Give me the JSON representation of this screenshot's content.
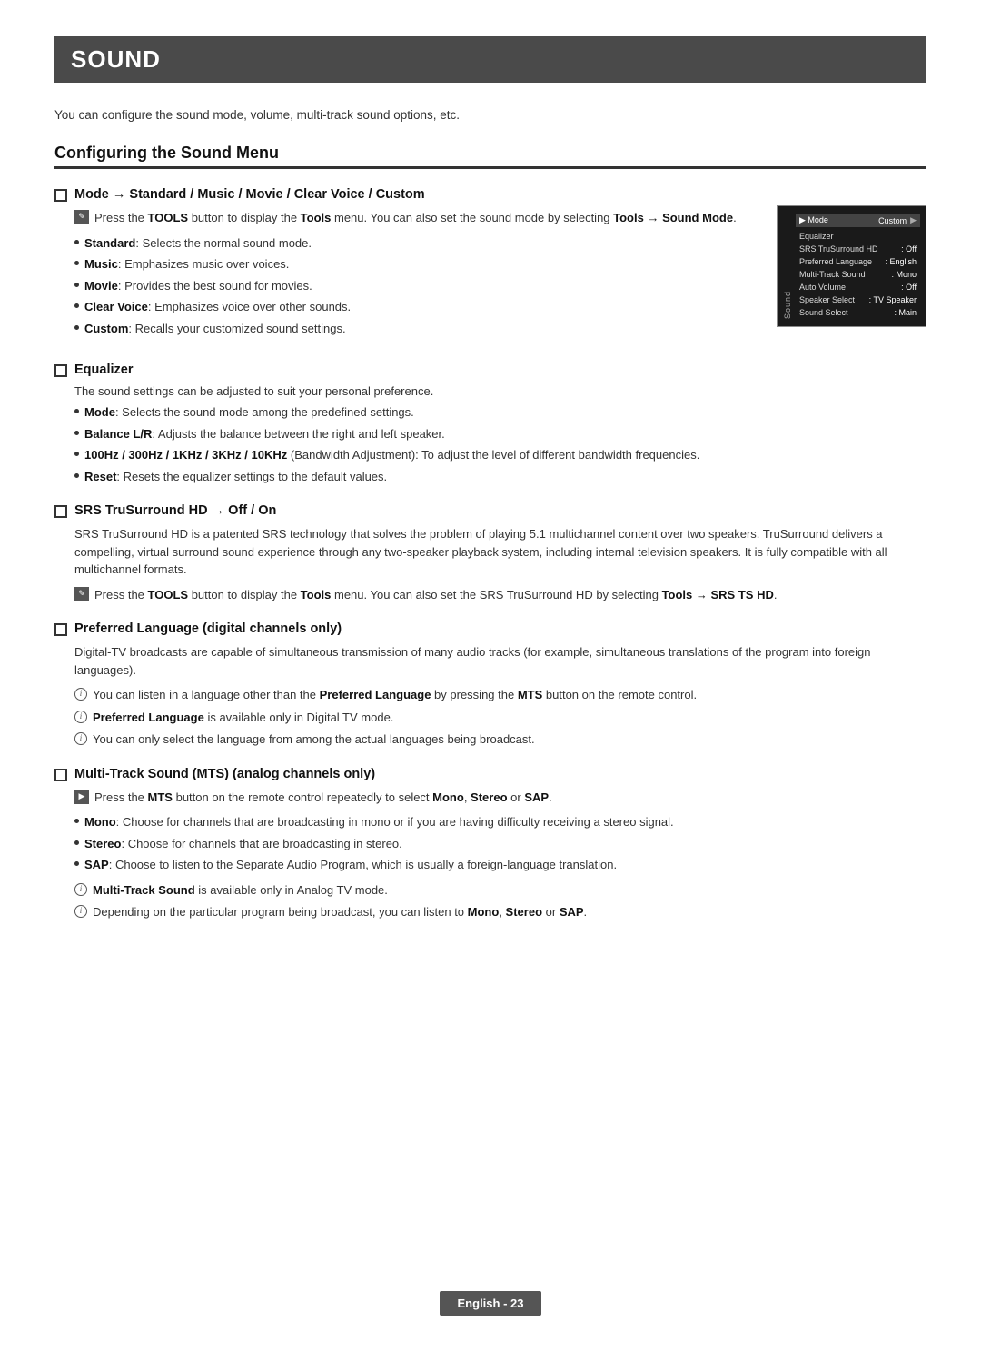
{
  "page": {
    "title": "SOUND",
    "intro": "You can configure the sound mode, volume, multi-track sound options, etc.",
    "footer": "English - 23",
    "section": {
      "title": "Configuring the Sound Menu",
      "subsections": [
        {
          "id": "mode",
          "title": "Mode → Standard / Music / Movie / Clear Voice / Custom",
          "tools_note": "Press the TOOLS button to display the Tools menu. You can also set the sound mode by selecting Tools → Sound Mode.",
          "bullets": [
            "<b>Standard</b>: Selects the normal sound mode.",
            "<b>Music</b>: Emphasizes music over voices.",
            "<b>Movie</b>: Provides the best sound for movies.",
            "<b>Clear Voice</b>: Emphasizes voice over other sounds.",
            "<b>Custom</b>: Recalls your customized sound settings."
          ],
          "tv_menu": {
            "label": "Sound",
            "mode_label": "Mode",
            "mode_value": "Custom",
            "rows": [
              {
                "label": "Equalizer",
                "value": ""
              },
              {
                "label": "SRS TruSurround HD",
                "value": ": Off"
              },
              {
                "label": "Preferred Language",
                "value": ": English"
              },
              {
                "label": "Multi-Track Sound",
                "value": ": Mono"
              },
              {
                "label": "Auto Volume",
                "value": ": Off"
              },
              {
                "label": "Speaker Select",
                "value": ": TV Speaker"
              },
              {
                "label": "Sound Select",
                "value": ": Main"
              }
            ]
          }
        },
        {
          "id": "equalizer",
          "title": "Equalizer",
          "intro": "The sound settings can be adjusted to suit your personal preference.",
          "bullets": [
            "<b>Mode</b>: Selects the sound mode among the predefined settings.",
            "<b>Balance L/R</b>: Adjusts the balance between the right and left speaker.",
            "<b>100Hz / 300Hz / 1KHz / 3KHz / 10KHz</b> (Bandwidth Adjustment): To adjust the level of different bandwidth frequencies.",
            "<b>Reset</b>: Resets the equalizer settings to the default values."
          ]
        },
        {
          "id": "srs",
          "title": "SRS TruSurround HD → Off / On",
          "intro": "SRS TruSurround HD is a patented SRS technology that solves the problem of playing 5.1 multichannel content over two speakers. TruSurround delivers a compelling, virtual surround sound experience through any two-speaker playback system, including internal television speakers. It is fully compatible with all multichannel formats.",
          "tools_note": "Press the TOOLS button to display the Tools menu. You can also set the SRS TruSurround HD by selecting Tools → SRS TS HD."
        },
        {
          "id": "preferred-language",
          "title": "Preferred Language (digital channels only)",
          "intro": "Digital-TV broadcasts are capable of simultaneous transmission of many audio tracks (for example, simultaneous translations of the program into foreign languages).",
          "info_notes": [
            "You can listen in a language other than the <b>Preferred Language</b> by pressing the <b>MTS</b> button on the remote control.",
            "<b>Preferred Language</b> is available only in Digital TV mode.",
            "You can only select the language from among the actual languages being broadcast."
          ]
        },
        {
          "id": "multi-track",
          "title": "Multi-Track Sound (MTS) (analog channels only)",
          "tools_note": "Press the MTS button on the remote control repeatedly to select Mono, Stereo or SAP.",
          "bullets": [
            "<b>Mono</b>: Choose for channels that are broadcasting in mono or if you are having difficulty receiving a stereo signal.",
            "<b>Stereo</b>: Choose for channels that are broadcasting in stereo.",
            "<b>SAP</b>: Choose to listen to the Separate Audio Program, which is usually a foreign-language translation."
          ],
          "info_notes": [
            "<b>Multi-Track Sound</b> is available only in Analog TV mode.",
            "Depending on the particular program being broadcast, you can listen to <b>Mono</b>, <b>Stereo</b> or <b>SAP</b>."
          ]
        }
      ]
    }
  }
}
